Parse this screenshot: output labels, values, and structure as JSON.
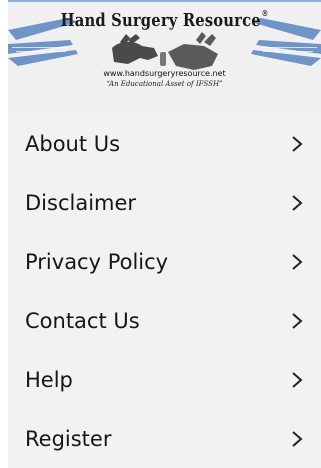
{
  "brand": {
    "title": "Hand Surgery Resource",
    "registered": "®",
    "url": "www.handsurgeryresource.net",
    "tagline": "“An Educational Asset of IFSSH”"
  },
  "menu": {
    "items": [
      {
        "label": "About Us",
        "icon": "chevron-right-icon"
      },
      {
        "label": "Disclaimer",
        "icon": "chevron-right-icon"
      },
      {
        "label": "Privacy Policy",
        "icon": "chevron-right-icon"
      },
      {
        "label": "Contact Us",
        "icon": "chevron-right-icon"
      },
      {
        "label": "Help",
        "icon": "chevron-right-icon"
      },
      {
        "label": "Register",
        "icon": "chevron-right-icon"
      }
    ]
  },
  "colors": {
    "background": "#f2f2f2",
    "text": "#161616",
    "logo_blue": "#6f94c8"
  }
}
